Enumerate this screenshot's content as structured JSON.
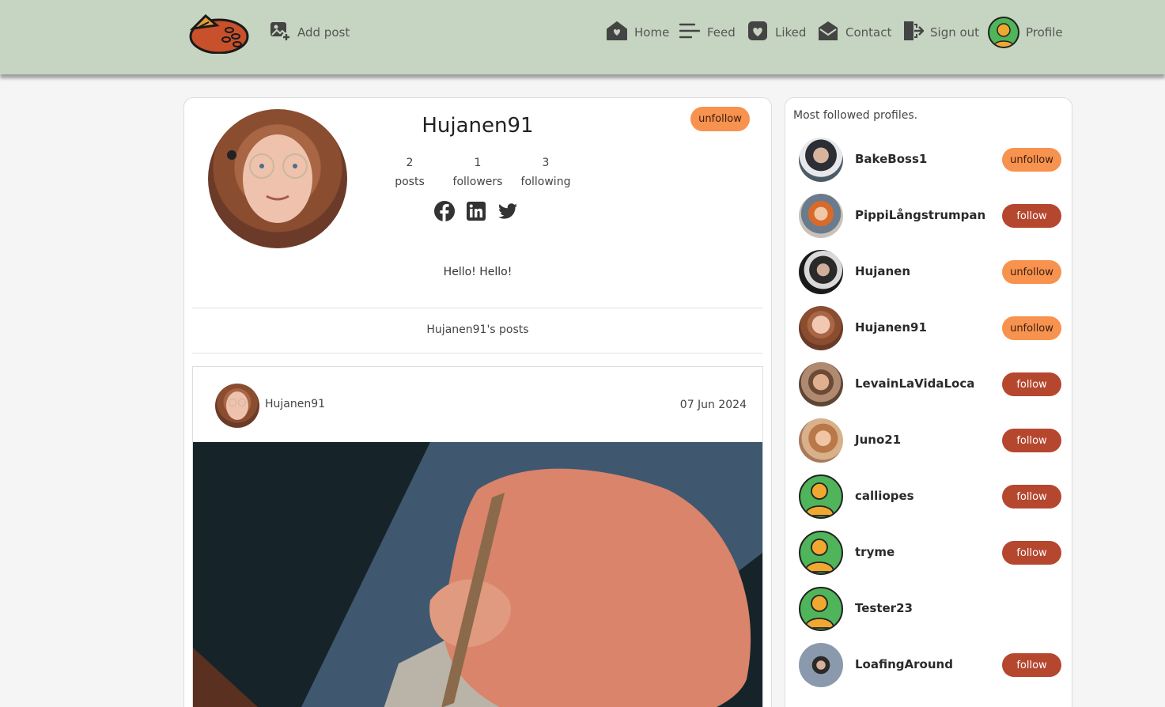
{
  "nav": {
    "add_post": "Add post",
    "home": "Home",
    "feed": "Feed",
    "liked": "Liked",
    "contact": "Contact",
    "sign_out": "Sign out",
    "profile": "Profile"
  },
  "profile": {
    "name": "Hujanen91",
    "action_label": "unfollow",
    "stats": [
      {
        "value": "2",
        "label": "posts"
      },
      {
        "value": "1",
        "label": "followers"
      },
      {
        "value": "3",
        "label": "following"
      }
    ],
    "socials": [
      "facebook-icon",
      "linkedin-icon",
      "twitter-icon"
    ],
    "bio": "Hello! Hello!",
    "posts_heading": "Hujanen91's posts"
  },
  "post": {
    "author": "Hujanen91",
    "date": "07 Jun 2024"
  },
  "sidebar": {
    "title": "Most followed profiles.",
    "profiles": [
      {
        "name": "BakeBoss1",
        "action": "unfollow"
      },
      {
        "name": "PippiLångstrumpan",
        "action": "follow"
      },
      {
        "name": "Hujanen",
        "action": "unfollow"
      },
      {
        "name": "Hujanen91",
        "action": "unfollow"
      },
      {
        "name": "LevainLaVidaLoca",
        "action": "follow"
      },
      {
        "name": "Juno21",
        "action": "follow"
      },
      {
        "name": "calliopes",
        "action": "follow"
      },
      {
        "name": "tryme",
        "action": "follow"
      },
      {
        "name": "Tester23",
        "action": ""
      },
      {
        "name": "LoafingAround",
        "action": "follow"
      }
    ]
  },
  "colors": {
    "navbar": "#c6d5c1",
    "unfollow": "#f7924f",
    "follow": "#b5472f"
  }
}
